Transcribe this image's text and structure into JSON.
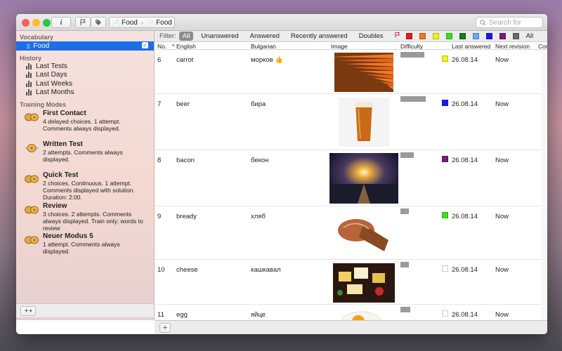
{
  "titlebar": {
    "info_label": "i",
    "breadcrumb": [
      "Food",
      "Food"
    ],
    "search_placeholder": "Search for"
  },
  "sidebar": {
    "vocabulary_heading": "Vocabulary",
    "selected_item": "Food",
    "history_heading": "History",
    "history_items": [
      "Last Tests",
      "Last Days",
      "Last Weeks",
      "Last Months"
    ],
    "training_heading": "Training Modes",
    "modes": [
      {
        "title": "First Contact",
        "desc": "4 delayed choices. 1 attempt. Comments always displayed."
      },
      {
        "title": "Written Test",
        "desc": "2 attempts. Comments always displayed."
      },
      {
        "title": "Quick Test",
        "desc": "2 choices. Continuous. 1 attempt. Comments displayed with solution. Duration: 2:00."
      },
      {
        "title": "Review",
        "desc": "3 choices. 2 attempts. Comments always displayed. Train only: words to review"
      },
      {
        "title": "Neuer Modus 5",
        "desc": "1 attempt. Comments always displayed."
      }
    ],
    "add_label": "+"
  },
  "filter": {
    "label": "Filter:",
    "chips": [
      "All",
      "Unanswered",
      "Answered",
      "Recently answered",
      "Doubles"
    ],
    "active_chip": "All",
    "colors": [
      "#e81a1a",
      "#ef7a1a",
      "#f5f01a",
      "#39e01a",
      "#1a7a1a",
      "#6aaaf0",
      "#1a1ae8",
      "#7a1a7a",
      "#6a6a6a"
    ],
    "all_colors_label": "All"
  },
  "table": {
    "columns": {
      "no": "No.",
      "english": "English",
      "bulgarian": "Bulgarian",
      "image": "Image",
      "difficulty": "Difficulty",
      "last_answered": "Last answered",
      "next_revision": "Next revision",
      "comments": "Com"
    },
    "rows": [
      {
        "no": "6",
        "english": "carrot",
        "bulgarian": "морков 👍",
        "difficulty": 0.7,
        "color": "#f5f01a",
        "last": "26.08.14",
        "next": "Now",
        "image": "carrot"
      },
      {
        "no": "7",
        "english": "beer",
        "bulgarian": "бира",
        "difficulty": 0.75,
        "color": "#1a1ae8",
        "last": "26.08.14",
        "next": "Now",
        "image": "beer"
      },
      {
        "no": "8",
        "english": "bacon",
        "bulgarian": "бекон",
        "difficulty": 0.4,
        "color": "#7a1a7a",
        "last": "26.08.14",
        "next": "Now",
        "image": "sunset"
      },
      {
        "no": "9",
        "english": "bready",
        "bulgarian": "хляб",
        "difficulty": 0.25,
        "color": "#39e01a",
        "last": "26.08.14",
        "next": "Now",
        "image": "bread"
      },
      {
        "no": "10",
        "english": "cheese",
        "bulgarian": "кашкавал",
        "difficulty": 0.25,
        "color": "#ffffff",
        "last": "26.08.14",
        "next": "Now",
        "image": "cheese"
      },
      {
        "no": "11",
        "english": "egg",
        "bulgarian": "яйце",
        "difficulty": 0.3,
        "color": "#ffffff",
        "last": "26.08.14",
        "next": "Now",
        "image": "egg"
      }
    ]
  }
}
